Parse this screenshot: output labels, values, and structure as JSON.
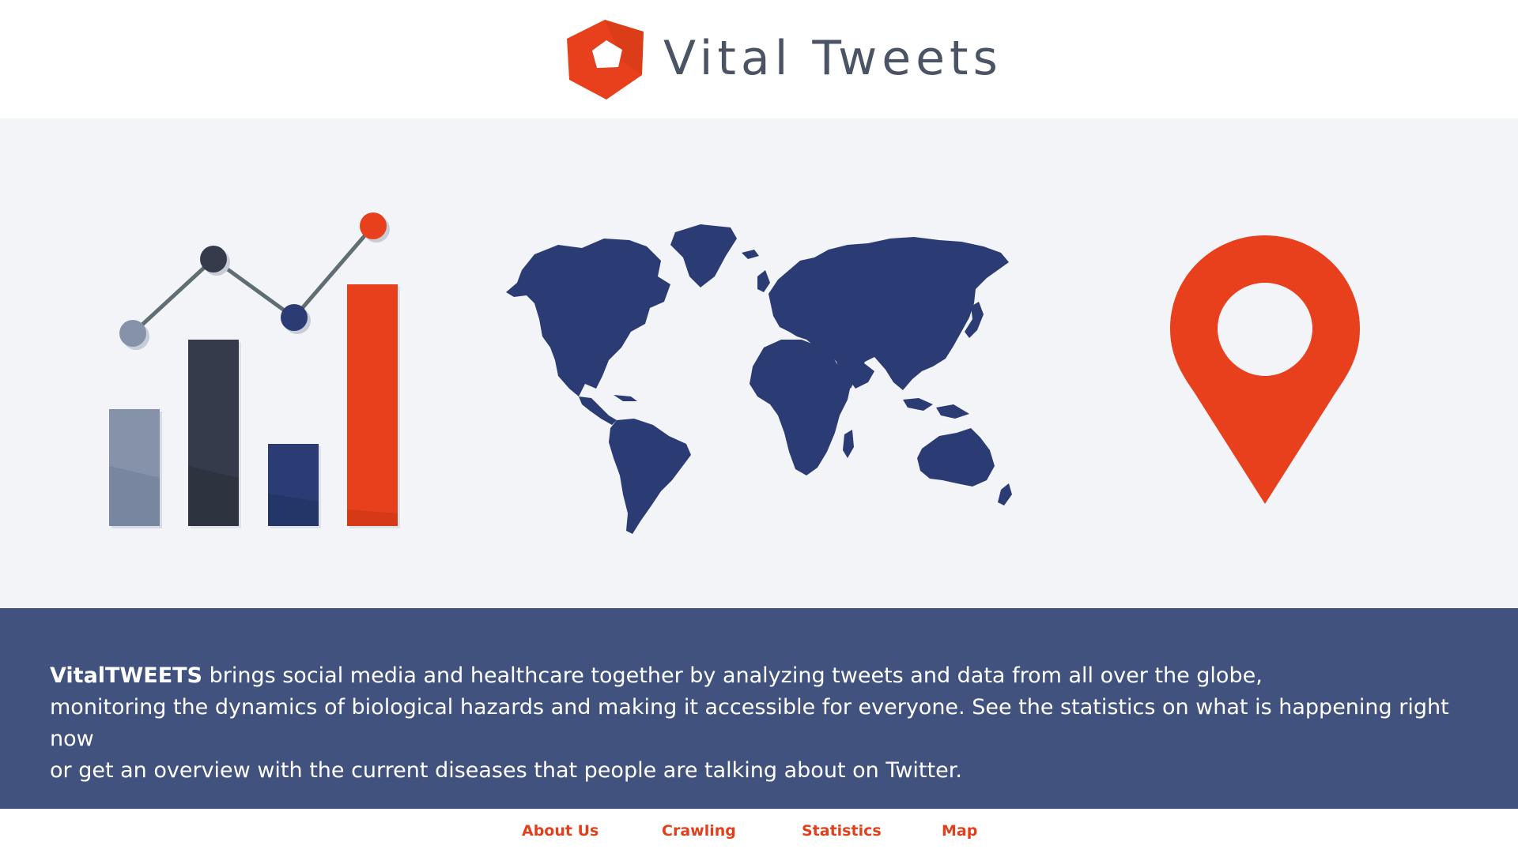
{
  "header": {
    "brand_name": "Vital Tweets",
    "logo_icon": "pentagon-logo-icon"
  },
  "hero": {
    "illustrations": [
      "bar-line-chart-icon",
      "world-map-icon",
      "map-pin-icon"
    ]
  },
  "description": {
    "brand_bold": "VitalTWEETS",
    "line1": " brings social media and healthcare together by analyzing tweets and data from all over the globe,",
    "line2": "monitoring the dynamics of biological hazards and making it accessible for everyone. See the statistics on what is happening right now",
    "line3": "or get an overview with the current diseases that people are talking about on Twitter."
  },
  "footer": {
    "links": [
      "About Us",
      "Crawling",
      "Statistics",
      "Map"
    ]
  },
  "colors": {
    "accent_orange": "#e8401c",
    "navy": "#2a3c73",
    "band_blue": "#41527f",
    "hero_bg": "#f3f4f8",
    "brand_text": "#4b5465"
  }
}
